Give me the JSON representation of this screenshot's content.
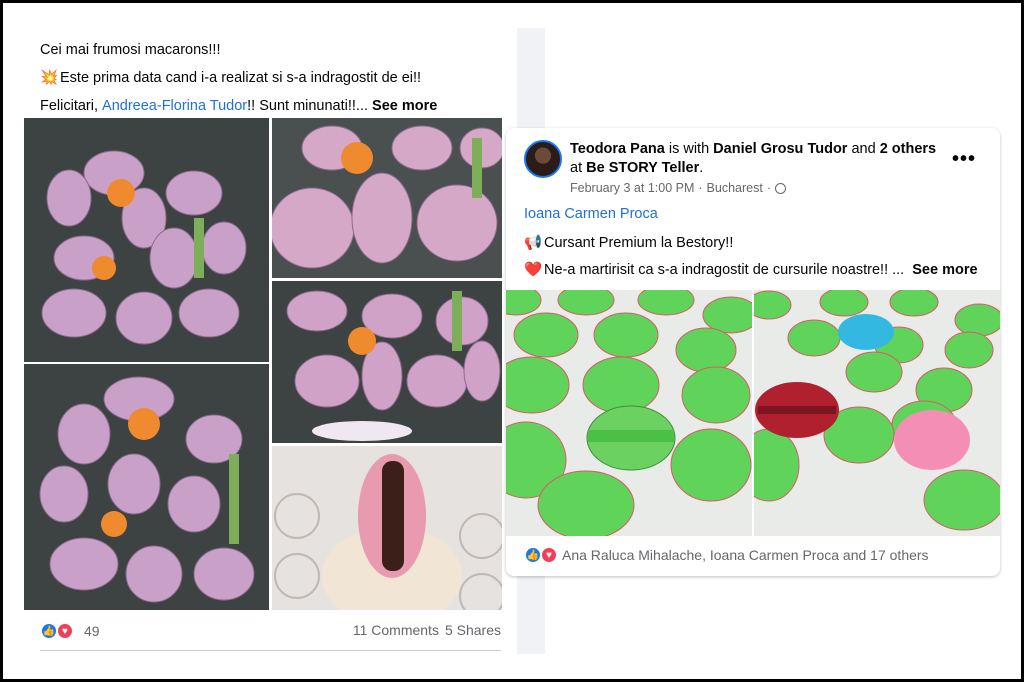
{
  "left_post": {
    "line1": "Cei mai frumosi macarons!!!",
    "line2_emoji": "💥",
    "line2": "Este prima data cand i-a realizat si s-a indragostit de ei!!",
    "line3_prefix": "Felicitari,",
    "line3_tag": "Andreea-Florina Tudor",
    "line3_suffix": "!! Sunt minunati!!...",
    "see_more": "See more",
    "reactions_count": "49",
    "comments": "11 Comments",
    "shares": "5 Shares"
  },
  "right_post": {
    "author": "Teodora Pana",
    "is_with": "is with",
    "with_name": "Daniel Grosu Tudor",
    "and": "and",
    "others": "2 others",
    "at": "at",
    "place": "Be STORY Teller",
    "period": ".",
    "date": "February 3 at 1:00 PM",
    "sep": "·",
    "location": "Bucharest",
    "sep2": "·",
    "more": "•••",
    "tag": "Ioana Carmen Proca",
    "line1_emoji": "📢",
    "line1": "Cursant Premium la Bestory!!",
    "line2_emoji": "❤️",
    "line2": "Ne-a martirisit ca s-a indragostit de cursurile noastre!! ...",
    "see_more": "See more",
    "reactions_text": "Ana Raluca Mihalache, Ioana Carmen Proca and 17 others"
  },
  "colors": {
    "link": "#216fdb",
    "like_blue": "#1877f2",
    "love_red": "#f33e58",
    "macaron_pink": "#d9a7c7",
    "macaron_green": "#5fd35a"
  }
}
